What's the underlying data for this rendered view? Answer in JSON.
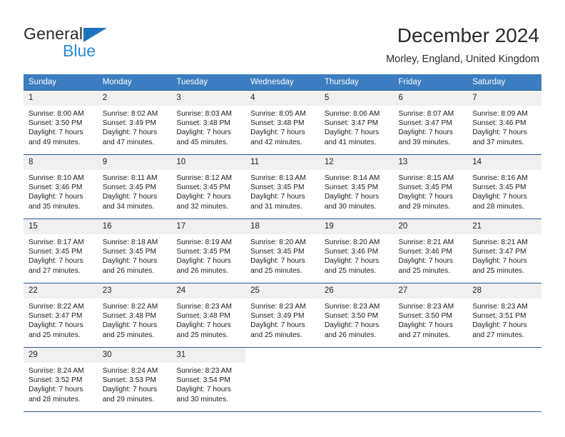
{
  "brand": {
    "name_top": "General",
    "name_bottom": "Blue",
    "accent_color": "#2e8ad4",
    "triangle_color": "#1f72bd"
  },
  "header": {
    "title": "December 2024",
    "subtitle": "Morley, England, United Kingdom"
  },
  "calendar": {
    "header_bg": "#3b7dc0",
    "header_text_color": "#ffffff",
    "daynum_bg": "#f0f0f0",
    "row_border_color": "#2b5c8f",
    "weekdays": [
      "Sunday",
      "Monday",
      "Tuesday",
      "Wednesday",
      "Thursday",
      "Friday",
      "Saturday"
    ],
    "weeks": [
      [
        {
          "day": "1",
          "sunrise": "Sunrise: 8:00 AM",
          "sunset": "Sunset: 3:50 PM",
          "daylight_line1": "Daylight: 7 hours",
          "daylight_line2": "and 49 minutes."
        },
        {
          "day": "2",
          "sunrise": "Sunrise: 8:02 AM",
          "sunset": "Sunset: 3:49 PM",
          "daylight_line1": "Daylight: 7 hours",
          "daylight_line2": "and 47 minutes."
        },
        {
          "day": "3",
          "sunrise": "Sunrise: 8:03 AM",
          "sunset": "Sunset: 3:48 PM",
          "daylight_line1": "Daylight: 7 hours",
          "daylight_line2": "and 45 minutes."
        },
        {
          "day": "4",
          "sunrise": "Sunrise: 8:05 AM",
          "sunset": "Sunset: 3:48 PM",
          "daylight_line1": "Daylight: 7 hours",
          "daylight_line2": "and 42 minutes."
        },
        {
          "day": "5",
          "sunrise": "Sunrise: 8:06 AM",
          "sunset": "Sunset: 3:47 PM",
          "daylight_line1": "Daylight: 7 hours",
          "daylight_line2": "and 41 minutes."
        },
        {
          "day": "6",
          "sunrise": "Sunrise: 8:07 AM",
          "sunset": "Sunset: 3:47 PM",
          "daylight_line1": "Daylight: 7 hours",
          "daylight_line2": "and 39 minutes."
        },
        {
          "day": "7",
          "sunrise": "Sunrise: 8:09 AM",
          "sunset": "Sunset: 3:46 PM",
          "daylight_line1": "Daylight: 7 hours",
          "daylight_line2": "and 37 minutes."
        }
      ],
      [
        {
          "day": "8",
          "sunrise": "Sunrise: 8:10 AM",
          "sunset": "Sunset: 3:46 PM",
          "daylight_line1": "Daylight: 7 hours",
          "daylight_line2": "and 35 minutes."
        },
        {
          "day": "9",
          "sunrise": "Sunrise: 8:11 AM",
          "sunset": "Sunset: 3:45 PM",
          "daylight_line1": "Daylight: 7 hours",
          "daylight_line2": "and 34 minutes."
        },
        {
          "day": "10",
          "sunrise": "Sunrise: 8:12 AM",
          "sunset": "Sunset: 3:45 PM",
          "daylight_line1": "Daylight: 7 hours",
          "daylight_line2": "and 32 minutes."
        },
        {
          "day": "11",
          "sunrise": "Sunrise: 8:13 AM",
          "sunset": "Sunset: 3:45 PM",
          "daylight_line1": "Daylight: 7 hours",
          "daylight_line2": "and 31 minutes."
        },
        {
          "day": "12",
          "sunrise": "Sunrise: 8:14 AM",
          "sunset": "Sunset: 3:45 PM",
          "daylight_line1": "Daylight: 7 hours",
          "daylight_line2": "and 30 minutes."
        },
        {
          "day": "13",
          "sunrise": "Sunrise: 8:15 AM",
          "sunset": "Sunset: 3:45 PM",
          "daylight_line1": "Daylight: 7 hours",
          "daylight_line2": "and 29 minutes."
        },
        {
          "day": "14",
          "sunrise": "Sunrise: 8:16 AM",
          "sunset": "Sunset: 3:45 PM",
          "daylight_line1": "Daylight: 7 hours",
          "daylight_line2": "and 28 minutes."
        }
      ],
      [
        {
          "day": "15",
          "sunrise": "Sunrise: 8:17 AM",
          "sunset": "Sunset: 3:45 PM",
          "daylight_line1": "Daylight: 7 hours",
          "daylight_line2": "and 27 minutes."
        },
        {
          "day": "16",
          "sunrise": "Sunrise: 8:18 AM",
          "sunset": "Sunset: 3:45 PM",
          "daylight_line1": "Daylight: 7 hours",
          "daylight_line2": "and 26 minutes."
        },
        {
          "day": "17",
          "sunrise": "Sunrise: 8:19 AM",
          "sunset": "Sunset: 3:45 PM",
          "daylight_line1": "Daylight: 7 hours",
          "daylight_line2": "and 26 minutes."
        },
        {
          "day": "18",
          "sunrise": "Sunrise: 8:20 AM",
          "sunset": "Sunset: 3:45 PM",
          "daylight_line1": "Daylight: 7 hours",
          "daylight_line2": "and 25 minutes."
        },
        {
          "day": "19",
          "sunrise": "Sunrise: 8:20 AM",
          "sunset": "Sunset: 3:46 PM",
          "daylight_line1": "Daylight: 7 hours",
          "daylight_line2": "and 25 minutes."
        },
        {
          "day": "20",
          "sunrise": "Sunrise: 8:21 AM",
          "sunset": "Sunset: 3:46 PM",
          "daylight_line1": "Daylight: 7 hours",
          "daylight_line2": "and 25 minutes."
        },
        {
          "day": "21",
          "sunrise": "Sunrise: 8:21 AM",
          "sunset": "Sunset: 3:47 PM",
          "daylight_line1": "Daylight: 7 hours",
          "daylight_line2": "and 25 minutes."
        }
      ],
      [
        {
          "day": "22",
          "sunrise": "Sunrise: 8:22 AM",
          "sunset": "Sunset: 3:47 PM",
          "daylight_line1": "Daylight: 7 hours",
          "daylight_line2": "and 25 minutes."
        },
        {
          "day": "23",
          "sunrise": "Sunrise: 8:22 AM",
          "sunset": "Sunset: 3:48 PM",
          "daylight_line1": "Daylight: 7 hours",
          "daylight_line2": "and 25 minutes."
        },
        {
          "day": "24",
          "sunrise": "Sunrise: 8:23 AM",
          "sunset": "Sunset: 3:48 PM",
          "daylight_line1": "Daylight: 7 hours",
          "daylight_line2": "and 25 minutes."
        },
        {
          "day": "25",
          "sunrise": "Sunrise: 8:23 AM",
          "sunset": "Sunset: 3:49 PM",
          "daylight_line1": "Daylight: 7 hours",
          "daylight_line2": "and 25 minutes."
        },
        {
          "day": "26",
          "sunrise": "Sunrise: 8:23 AM",
          "sunset": "Sunset: 3:50 PM",
          "daylight_line1": "Daylight: 7 hours",
          "daylight_line2": "and 26 minutes."
        },
        {
          "day": "27",
          "sunrise": "Sunrise: 8:23 AM",
          "sunset": "Sunset: 3:50 PM",
          "daylight_line1": "Daylight: 7 hours",
          "daylight_line2": "and 27 minutes."
        },
        {
          "day": "28",
          "sunrise": "Sunrise: 8:23 AM",
          "sunset": "Sunset: 3:51 PM",
          "daylight_line1": "Daylight: 7 hours",
          "daylight_line2": "and 27 minutes."
        }
      ],
      [
        {
          "day": "29",
          "sunrise": "Sunrise: 8:24 AM",
          "sunset": "Sunset: 3:52 PM",
          "daylight_line1": "Daylight: 7 hours",
          "daylight_line2": "and 28 minutes."
        },
        {
          "day": "30",
          "sunrise": "Sunrise: 8:24 AM",
          "sunset": "Sunset: 3:53 PM",
          "daylight_line1": "Daylight: 7 hours",
          "daylight_line2": "and 29 minutes."
        },
        {
          "day": "31",
          "sunrise": "Sunrise: 8:23 AM",
          "sunset": "Sunset: 3:54 PM",
          "daylight_line1": "Daylight: 7 hours",
          "daylight_line2": "and 30 minutes."
        },
        {
          "day": "",
          "sunrise": "",
          "sunset": "",
          "daylight_line1": "",
          "daylight_line2": ""
        },
        {
          "day": "",
          "sunrise": "",
          "sunset": "",
          "daylight_line1": "",
          "daylight_line2": ""
        },
        {
          "day": "",
          "sunrise": "",
          "sunset": "",
          "daylight_line1": "",
          "daylight_line2": ""
        },
        {
          "day": "",
          "sunrise": "",
          "sunset": "",
          "daylight_line1": "",
          "daylight_line2": ""
        }
      ]
    ]
  }
}
